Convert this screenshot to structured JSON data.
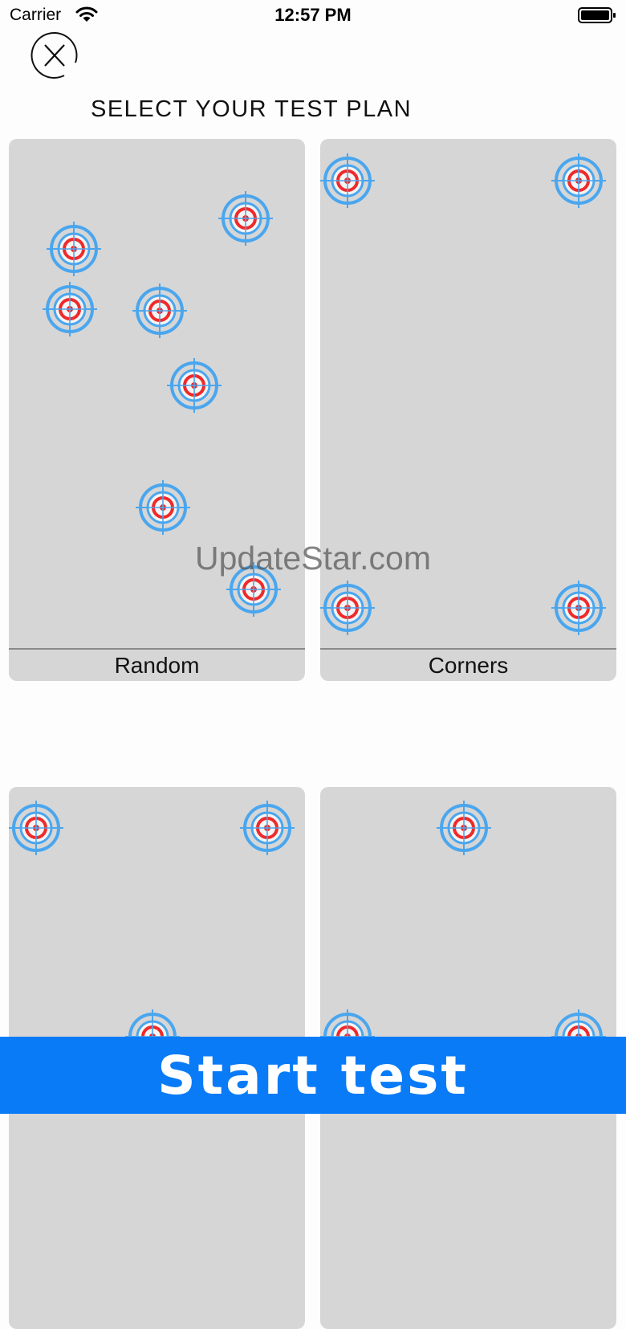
{
  "status_bar": {
    "carrier": "Carrier",
    "time": "12:57 PM"
  },
  "header": {
    "close_icon": "close-circle-x-icon",
    "title": "SELECT YOUR TEST PLAN"
  },
  "plans": [
    {
      "label": "Random"
    },
    {
      "label": "Corners"
    },
    {
      "label": ""
    },
    {
      "label": ""
    }
  ],
  "watermark": "UpdateStar.com",
  "start_button": {
    "label": "Start test"
  },
  "colors": {
    "accent": "#0a7bf7",
    "card": "#d6d6d6",
    "target_ring": "#4aa6ee",
    "target_center": "#ef2a2a"
  }
}
